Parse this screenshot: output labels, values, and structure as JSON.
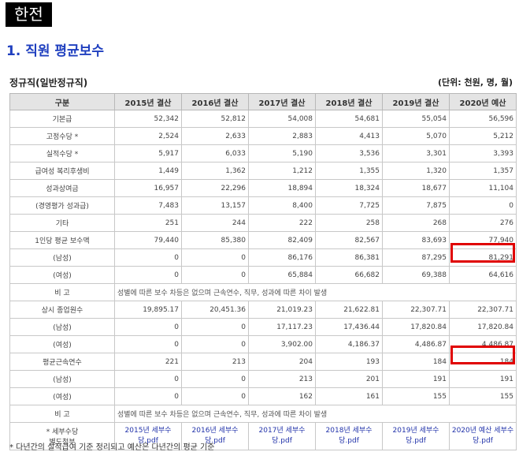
{
  "company": "한전",
  "section_heading": "1. 직원 평균보수",
  "table_title": "정규직(일반정규직)",
  "unit_note": "(단위: 천원, 명, 월)",
  "columns": [
    "구분",
    "2015년 결산",
    "2016년 결산",
    "2017년 결산",
    "2018년 결산",
    "2019년 결산",
    "2020년 예산"
  ],
  "rows": [
    {
      "label": "기본급",
      "values": [
        "52,342",
        "52,812",
        "54,008",
        "54,681",
        "55,054",
        "56,596"
      ]
    },
    {
      "label": "고정수당 *",
      "values": [
        "2,524",
        "2,633",
        "2,883",
        "4,413",
        "5,070",
        "5,212"
      ]
    },
    {
      "label": "실적수당 *",
      "values": [
        "5,917",
        "6,033",
        "5,190",
        "3,536",
        "3,301",
        "3,393"
      ]
    },
    {
      "label": "급여성 복리후생비",
      "values": [
        "1,449",
        "1,362",
        "1,212",
        "1,355",
        "1,320",
        "1,357"
      ]
    },
    {
      "label": "성과상여금",
      "values": [
        "16,957",
        "22,296",
        "18,894",
        "18,324",
        "18,677",
        "11,104"
      ]
    },
    {
      "label": "(경영평가 성과급)",
      "values": [
        "7,483",
        "13,157",
        "8,400",
        "7,725",
        "7,875",
        "0"
      ]
    },
    {
      "label": "기타",
      "values": [
        "251",
        "244",
        "222",
        "258",
        "268",
        "276"
      ]
    },
    {
      "label": "1인당 평균 보수액",
      "values": [
        "79,440",
        "85,380",
        "82,409",
        "82,567",
        "83,693",
        "77,940"
      ]
    },
    {
      "label": "(남성)",
      "values": [
        "0",
        "0",
        "86,176",
        "86,381",
        "87,295",
        "81,291"
      ]
    },
    {
      "label": "(여성)",
      "values": [
        "0",
        "0",
        "65,884",
        "66,682",
        "69,388",
        "64,616"
      ]
    }
  ],
  "note_row_1": {
    "label": "비 고",
    "text": "성별에 따른 보수 차등은 없으며 근속연수, 직무, 성과에 따른 차이 발생"
  },
  "rows_2": [
    {
      "label": "상시 종업원수",
      "values": [
        "19,895.17",
        "20,451.36",
        "21,019.23",
        "21,622.81",
        "22,307.71",
        "22,307.71"
      ]
    },
    {
      "label": "(남성)",
      "values": [
        "0",
        "0",
        "17,117.23",
        "17,436.44",
        "17,820.84",
        "17,820.84"
      ]
    },
    {
      "label": "(여성)",
      "values": [
        "0",
        "0",
        "3,902.00",
        "4,186.37",
        "4,486.87",
        "4,486.87"
      ]
    },
    {
      "label": "평균근속연수",
      "values": [
        "221",
        "213",
        "204",
        "193",
        "184",
        "184"
      ]
    },
    {
      "label": "(남성)",
      "values": [
        "0",
        "0",
        "213",
        "201",
        "191",
        "191"
      ]
    },
    {
      "label": "(여성)",
      "values": [
        "0",
        "0",
        "162",
        "161",
        "155",
        "155"
      ]
    }
  ],
  "note_row_2": {
    "label": "비 고",
    "text": "성별에 따른 보수 차등은 없으며 근속연수, 직무, 성과에 따른 차이 발생"
  },
  "file_row": {
    "label_line1": "* 세부수당",
    "label_line2": "별도첨부",
    "files": [
      "2015년 세부수당.pdf",
      "2016년 세부수당.pdf",
      "2017년 세부수당.pdf",
      "2018년 세부수당.pdf",
      "2019년 세부수당.pdf",
      "2020년 예산 세부수당.pdf"
    ]
  },
  "bottom_note": "* 다년간의 실적급여 기준 정리되고 예산은 다년간의 평균 기준"
}
